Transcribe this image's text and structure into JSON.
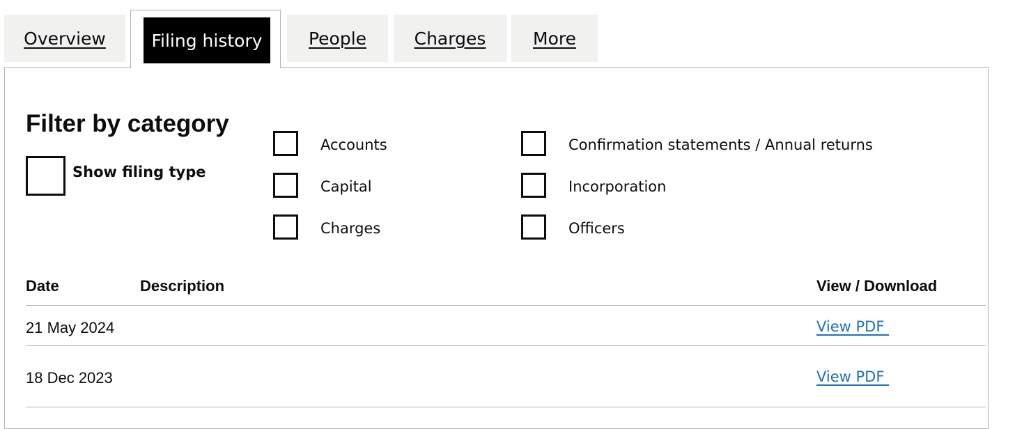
{
  "tabs": [
    {
      "label": "Overview",
      "active": false
    },
    {
      "label": "Filing history",
      "active": true
    },
    {
      "label": "People",
      "active": false
    },
    {
      "label": "Charges",
      "active": false
    },
    {
      "label": "More",
      "active": false
    }
  ],
  "filter": {
    "heading": "Filter by category",
    "show_filing_type_label": "Show filing type",
    "show_filing_type_checked": false,
    "categories": [
      {
        "label": "Accounts",
        "checked": false
      },
      {
        "label": "Capital",
        "checked": false
      },
      {
        "label": "Charges",
        "checked": false
      },
      {
        "label": "Confirmation statements / Annual returns",
        "checked": false
      },
      {
        "label": "Incorporation",
        "checked": false
      },
      {
        "label": "Officers",
        "checked": false
      }
    ]
  },
  "table": {
    "headers": {
      "date": "Date",
      "description": "Description",
      "view": "View / Download"
    },
    "rows": [
      {
        "date": "21 May 2024",
        "description": "",
        "link": "View PDF "
      },
      {
        "date": "18 Dec 2023",
        "description": "",
        "link": "View PDF "
      }
    ]
  },
  "colors": {
    "link": "#1d70b8",
    "active_tab_bg": "#000000",
    "inactive_tab_bg": "#f1f1f0",
    "border": "#b1b4b6"
  }
}
